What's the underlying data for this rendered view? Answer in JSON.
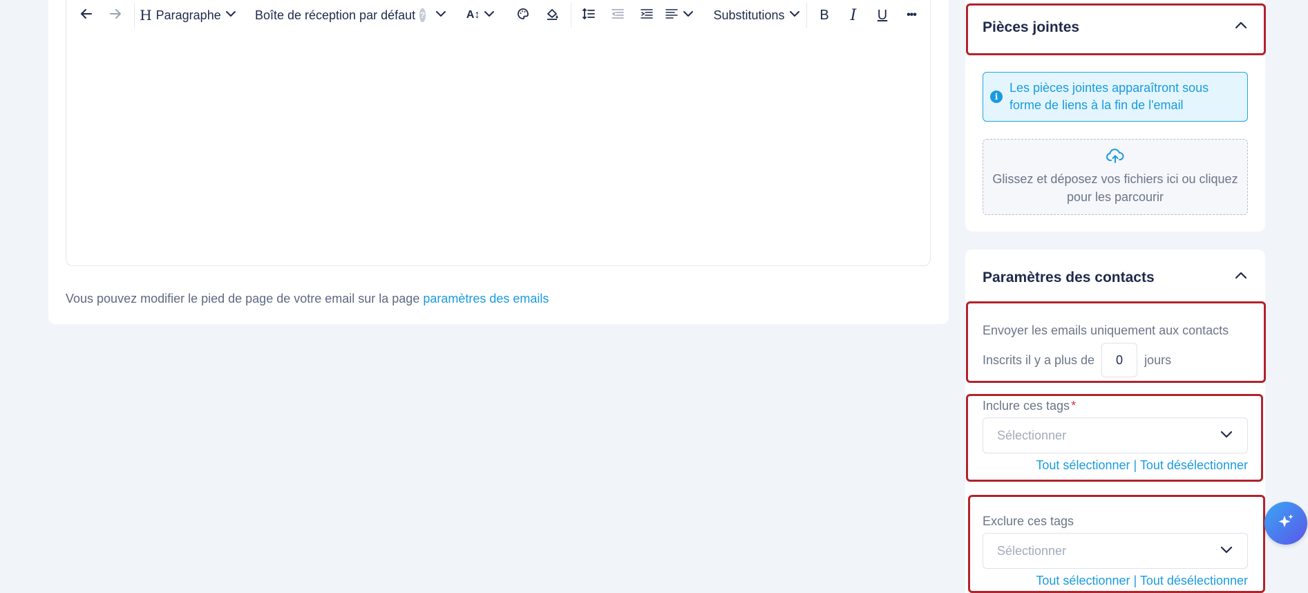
{
  "toolbar": {
    "paragraph_label": "Paragraphe",
    "inbox_label": "Boîte de réception par défaut",
    "help_glyph": "?",
    "font_size_label": "A↕",
    "substitutions_label": "Substitutions",
    "bold_label": "B",
    "italic_label": "I",
    "underline_label": "U",
    "more_label": "•••"
  },
  "editor": {
    "footer_text": "Vous pouvez modifier le pied de page de votre email sur la page",
    "footer_link": "paramètres des emails"
  },
  "attachments": {
    "title": "Pièces jointes",
    "info_text": "Les pièces jointes apparaîtront sous forme de liens à la fin de l'email",
    "dropzone_text": "Glissez et déposez vos fichiers ici ou cliquez pour les parcourir"
  },
  "contacts": {
    "title": "Paramètres des contacts",
    "send_only_label": "Envoyer les emails uniquement aux contacts",
    "registered_prefix": "Inscrits il y a plus de",
    "days_value": "0",
    "days_suffix": "jours",
    "include_label": "Inclure ces tags",
    "required_mark": "*",
    "include_placeholder": "Sélectionner",
    "exclude_label": "Exclure ces tags",
    "exclude_placeholder": "Sélectionner",
    "select_all": "Tout sélectionner",
    "separator": "|",
    "deselect_all": "Tout désélectionner"
  },
  "colors": {
    "accent": "#1a9be0",
    "highlight_border": "#b0232c",
    "title": "#1e2a4a"
  }
}
